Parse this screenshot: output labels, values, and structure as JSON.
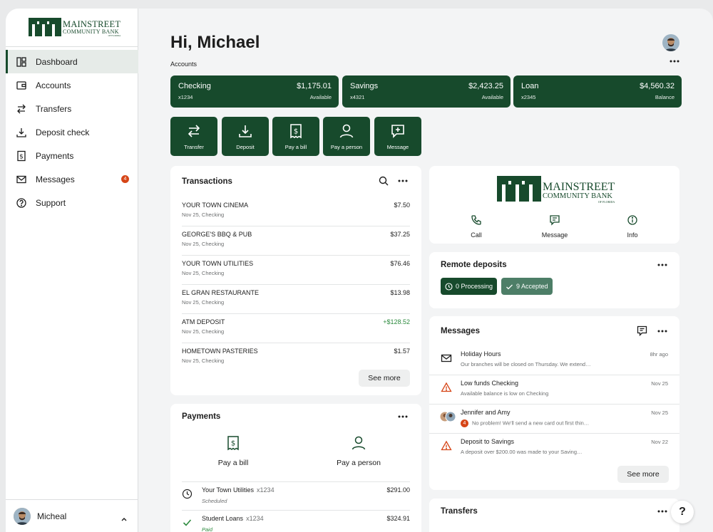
{
  "brand": {
    "logo_line1": "MAINSTREET",
    "logo_line2": "COMMUNITY BANK",
    "logo_line3": "OF FLORIDA"
  },
  "sidebar": {
    "items": [
      {
        "label": "Dashboard",
        "icon": "dashboard-icon"
      },
      {
        "label": "Accounts",
        "icon": "wallet-icon"
      },
      {
        "label": "Transfers",
        "icon": "transfer-icon"
      },
      {
        "label": "Deposit check",
        "icon": "download-icon"
      },
      {
        "label": "Payments",
        "icon": "bill-icon"
      },
      {
        "label": "Messages",
        "icon": "mail-icon",
        "badge": "4"
      },
      {
        "label": "Support",
        "icon": "help-circle-icon"
      }
    ],
    "user_name": "Micheal"
  },
  "header": {
    "greeting": "Hi, Michael",
    "accounts_label": "Accounts"
  },
  "accounts": [
    {
      "name": "Checking",
      "number": "x1234",
      "amount": "$1,175.01",
      "label": "Available"
    },
    {
      "name": "Savings",
      "number": "x4321",
      "amount": "$2,423.25",
      "label": "Available"
    },
    {
      "name": "Loan",
      "number": "x2345",
      "amount": "$4,560.32",
      "label": "Balance"
    }
  ],
  "quick_actions": [
    {
      "label": "Transfer",
      "icon": "transfer-icon"
    },
    {
      "label": "Deposit",
      "icon": "download-icon"
    },
    {
      "label": "Pay a bill",
      "icon": "bill-icon"
    },
    {
      "label": "Pay a person",
      "icon": "person-icon"
    },
    {
      "label": "Message",
      "icon": "message-icon"
    }
  ],
  "transactions": {
    "title": "Transactions",
    "rows": [
      {
        "name": "YOUR TOWN CINEMA",
        "sub": "Nov 25, Checking",
        "amount": "$7.50"
      },
      {
        "name": "GEORGE'S BBQ & PUB",
        "sub": "Nov 25, Checking",
        "amount": "$37.25"
      },
      {
        "name": "YOUR TOWN UTILITIES",
        "sub": "Nov 25, Checking",
        "amount": "$76.46"
      },
      {
        "name": "EL GRAN RESTAURANTE",
        "sub": "Nov 25, Checking",
        "amount": "$13.98"
      },
      {
        "name": "ATM DEPOSIT",
        "sub": "Nov 25, Checking",
        "amount": "+$128.52"
      },
      {
        "name": "HOMETOWN PASTERIES",
        "sub": "Nov 25, Checking",
        "amount": "$1.57"
      }
    ],
    "see_more": "See more"
  },
  "payments": {
    "title": "Payments",
    "options": [
      {
        "label": "Pay a bill",
        "icon": "bill-icon"
      },
      {
        "label": "Pay a person",
        "icon": "person-icon"
      }
    ],
    "rows": [
      {
        "name": "Your Town Utilities",
        "acct": "x1234",
        "status": "Scheduled",
        "amount": "$291.00",
        "icon": "clock-icon"
      },
      {
        "name": "Student Loans",
        "acct": "x1234",
        "status": "Paid",
        "amount": "$324.91",
        "icon": "check-icon"
      }
    ]
  },
  "bank_card": {
    "actions": [
      {
        "label": "Call",
        "icon": "phone-icon"
      },
      {
        "label": "Message",
        "icon": "message-icon"
      },
      {
        "label": "Info",
        "icon": "info-icon"
      }
    ]
  },
  "remote_deposits": {
    "title": "Remote deposits",
    "processing": "0 Processing",
    "accepted": "9 Accepted"
  },
  "messages": {
    "title": "Messages",
    "rows": [
      {
        "title": "Holiday Hours",
        "body": "Our branches will be closed on Thursday. We extend…",
        "time": "8hr ago",
        "icon": "mail-icon"
      },
      {
        "title": "Low funds Checking",
        "body": "Available balance is low on Checking",
        "time": "Nov 25",
        "icon": "warning-icon"
      },
      {
        "title": "Jennifer and Amy",
        "body": "No problem! We'll send a new card out first thin…",
        "time": "Nov 25",
        "icon": "group-avatar-icon",
        "badge": "4"
      },
      {
        "title": "Deposit to Savings",
        "body": "A deposit over $200.00 was made to your Saving…",
        "time": "Nov 22",
        "icon": "warning-icon"
      }
    ],
    "see_more": "See more"
  },
  "transfers": {
    "title": "Transfers"
  },
  "help": "?",
  "colors": {
    "brand_green": "#174a2c",
    "alert_orange": "#d64517",
    "positive_green": "#2c8a3e"
  }
}
